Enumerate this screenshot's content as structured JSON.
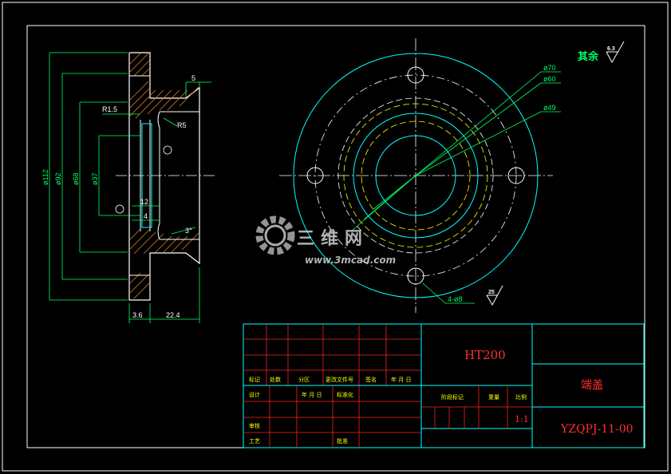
{
  "dims": {
    "d112": "ø112",
    "d92": "ø92",
    "d68": "ø68",
    "d37": "ø37",
    "r15": "R1.5",
    "r5": "R5",
    "five": "5",
    "twelve": "12",
    "four": "4",
    "angle3": "3°",
    "v36": "3.6",
    "v224": "22.4",
    "p70": "ø70",
    "p60": "ø60",
    "p49": "ø49",
    "holes": "4-ø8"
  },
  "roughness": {
    "other_label": "其余",
    "other_value": "6.3",
    "surface_value": "25"
  },
  "title_block": {
    "material": "HT200",
    "part_name": "端盖",
    "drawing_no": "YZQPJ-11-00",
    "scale": "1:1",
    "row_labels": [
      "标记",
      "处数",
      "分区",
      "更改文件号",
      "签名",
      "年 月 日"
    ],
    "design": "设计",
    "year_month": "年 月 日",
    "std": "标准化",
    "review": "审核",
    "process": "工艺",
    "approve": "批准",
    "stage_mark": "阶段标记",
    "weight": "重量",
    "ratio": "比例"
  },
  "watermark": {
    "brand": "三维网",
    "url": "www.3mcad.com"
  }
}
